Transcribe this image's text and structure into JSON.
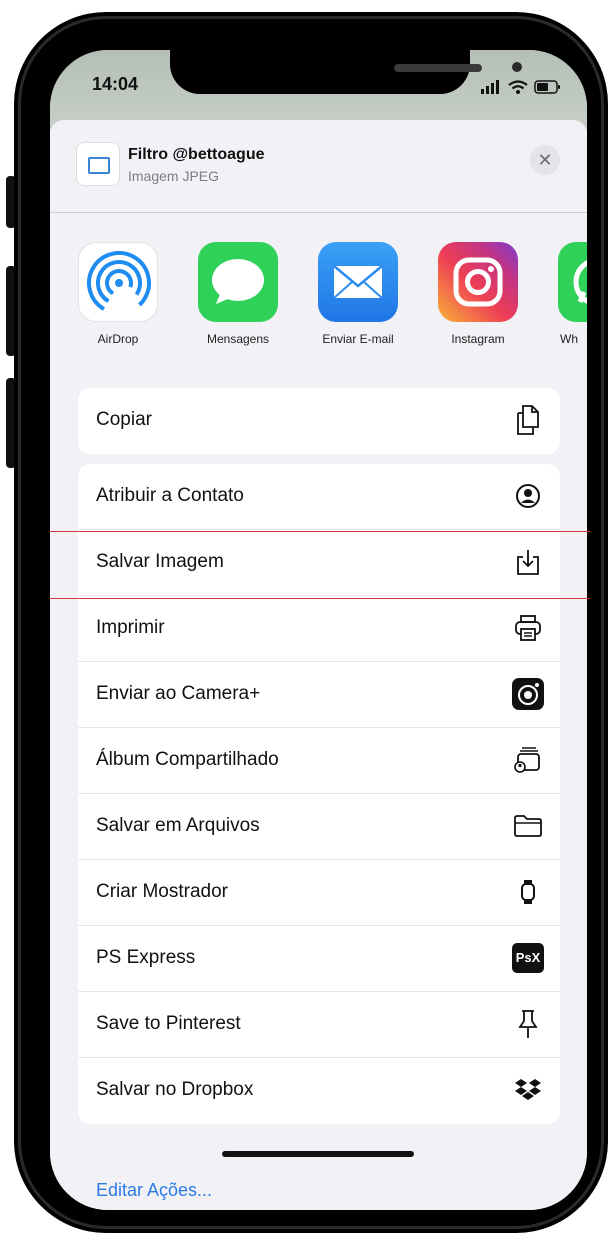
{
  "status": {
    "time": "14:04"
  },
  "header": {
    "title": "Filtro @bettoague",
    "subtitle": "Imagem JPEG",
    "close_icon": "close-icon"
  },
  "apps": [
    {
      "label": "AirDrop",
      "icon": "airdrop-icon"
    },
    {
      "label": "Mensagens",
      "icon": "messages-icon"
    },
    {
      "label": "Enviar E-mail",
      "icon": "mail-icon"
    },
    {
      "label": "Instagram",
      "icon": "instagram-icon"
    },
    {
      "label": "Wh",
      "icon": "whatsapp-icon"
    }
  ],
  "actions": {
    "copiar": "Copiar",
    "atribuir": "Atribuir a Contato",
    "salvar_imagem": "Salvar Imagem",
    "imprimir": "Imprimir",
    "camera_plus": "Enviar ao Camera+",
    "album": "Álbum Compartilhado",
    "arquivos": "Salvar em Arquivos",
    "mostrador": "Criar Mostrador",
    "ps_express": "PS Express",
    "pinterest": "Save to Pinterest",
    "dropbox": "Salvar no Dropbox",
    "psx_badge": "PsX"
  },
  "footer": {
    "edit_label": "Editar Ações..."
  },
  "colors": {
    "accent": "#2c7be5",
    "messages": "#2fd158",
    "mail": "#2a8cf0",
    "highlight_line": "#cf3b3b"
  }
}
